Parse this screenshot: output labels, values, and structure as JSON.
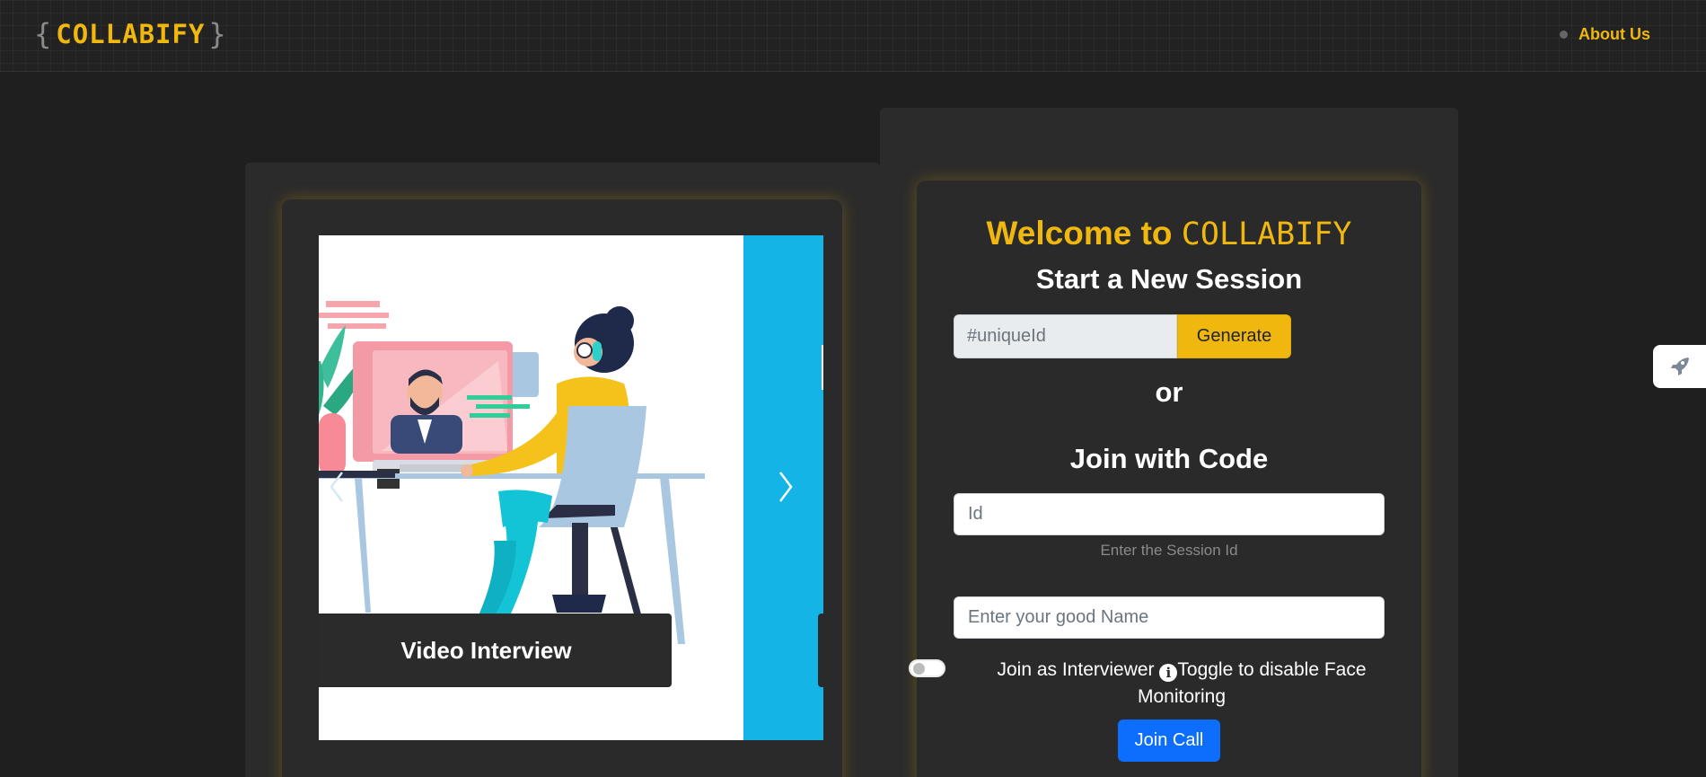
{
  "header": {
    "logo_open": "{",
    "logo_name": "COLLABIFY",
    "logo_close": "}",
    "about_label": "About Us"
  },
  "carousel": {
    "caption": "Video Interview",
    "prev_icon": "chevron-left-icon",
    "next_icon": "chevron-right-icon"
  },
  "session": {
    "welcome_prefix": "Welcome to ",
    "welcome_brand": "COLLABIFY",
    "start_heading": "Start a New Session",
    "unique_placeholder": "#uniqueId",
    "generate_label": "Generate",
    "or_text": "or",
    "join_heading": "Join with Code",
    "id_placeholder": "Id",
    "id_help": "Enter the Session Id",
    "name_placeholder": "Enter your good Name",
    "toggle_label": "Join as Interviewer",
    "info_symbol": "i",
    "toggle_hint": "Toggle to disable Face Monitoring",
    "join_label": "Join Call"
  },
  "side_tab": {
    "icon": "rocket-icon"
  },
  "colors": {
    "accent": "#f0b70f",
    "primary_button": "#0d6efd",
    "background": "#1f1f1f",
    "card": "#2a2a2a",
    "slide_blue": "#14b4e6"
  }
}
